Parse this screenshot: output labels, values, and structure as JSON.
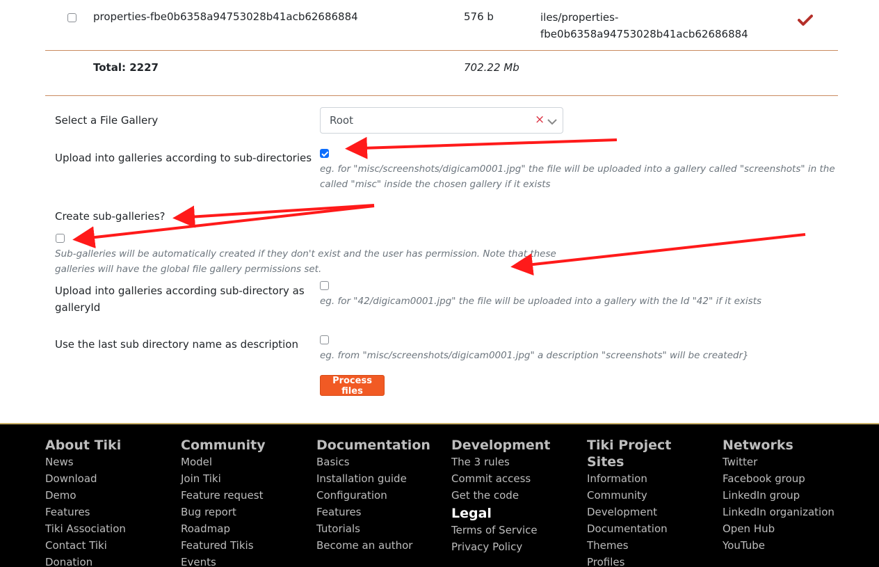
{
  "file_row": {
    "name": "properties-fbe0b6358a94753028b41acb62686884",
    "size": "576 b",
    "path_line1": "iles/properties-",
    "path_line2": "fbe0b6358a94753028b41acb62686884",
    "status_icon": "checkmark-icon"
  },
  "totals": {
    "label": "Total: 2227",
    "size": "702.22 Mb"
  },
  "form": {
    "gallery_label": "Select a File Gallery",
    "gallery_value": "Root",
    "clear_symbol": "×",
    "subdirs_label": "Upload into galleries according to sub-directories",
    "subdirs_checked": true,
    "subdirs_help_1": "eg. for \"misc/screenshots/digicam0001.jpg\" the file will be uploaded into a gallery called \"screenshots\" in the",
    "subdirs_help_2": "called \"misc\" inside the chosen gallery if it exists",
    "create_label": "Create sub-galleries?",
    "create_checked": false,
    "create_help_1": "Sub-galleries will be automatically created if they don't exist and the user has permission. Note that these",
    "create_help_2": "galleries will have the global file gallery permissions set.",
    "galleryid_label_1": "Upload into galleries according sub-directory as",
    "galleryid_label_2": "galleryId",
    "galleryid_checked": false,
    "galleryid_help": "eg. for \"42/digicam0001.jpg\" the file will be uploaded into a gallery with the Id \"42\" if it exists",
    "desc_label": "Use the last sub directory name as description",
    "desc_checked": false,
    "desc_help": "eg. from \"misc/screenshots/digicam0001.jpg\" a description \"screenshots\" will be createdr}",
    "process_button": "Process files"
  },
  "colors": {
    "accent": "#f15a24",
    "checkmark": "#b5302a",
    "annotation": "#ff1a1a",
    "footer_bg": "#000000"
  },
  "footer": {
    "columns": [
      {
        "heading": "About Tiki",
        "items": [
          "News",
          "Download",
          "Demo",
          "Features",
          "Tiki Association",
          "Contact Tiki",
          "Donation"
        ]
      },
      {
        "heading": "Community",
        "items": [
          "Model",
          "Join Tiki",
          "Feature request",
          "Bug report",
          "Roadmap",
          "Featured Tikis",
          "Events"
        ]
      },
      {
        "heading": "Documentation",
        "items": [
          "Basics",
          "Installation guide",
          "Configuration",
          "Features",
          "Tutorials",
          "Become an author"
        ]
      },
      {
        "heading": "Development",
        "items": [
          "The 3 rules",
          "Commit access",
          "Get the code"
        ]
      },
      {
        "heading_line1": "Tiki Project",
        "heading_line2": "Sites",
        "items": [
          "Information",
          "Community",
          "Development",
          "Documentation",
          "Themes",
          "Profiles"
        ]
      },
      {
        "heading": "Networks",
        "items": [
          "Twitter",
          "Facebook group",
          "LinkedIn group",
          "LinkedIn organization",
          "Open Hub",
          "YouTube"
        ]
      }
    ],
    "legal": {
      "heading": "Legal",
      "items": [
        "Terms of Service",
        "Privacy Policy"
      ]
    }
  }
}
